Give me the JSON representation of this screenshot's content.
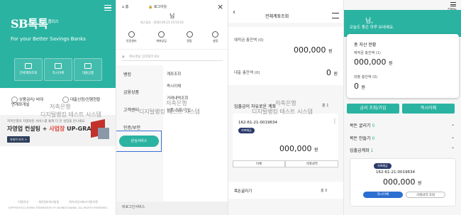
{
  "panel1": {
    "logo": "SB톡톡",
    "logo_suffix": "플러스",
    "tagline": "For your Better Savings Banks",
    "quick_buttons": [
      "전체계좌조회",
      "즉시이체",
      "대출상품"
    ],
    "sublink_left": "상품금리/ 비대면계좌개설",
    "sublink_right": "대출신청/진행현황",
    "banner": {
      "small": "저축은행의 차별화된 서비스를 통해 더 큰 성장을 만나세요",
      "main": "자영업 컨설팅 + 사업장 UP-GRADE",
      "main_a": "자영업 컨설팅 + ",
      "main_b": "사업장",
      "main_c": " UP-GRADE",
      "cta": "자세히 보기 >"
    },
    "footer": [
      "이용안내",
      "개인정보처리방침",
      "위치기반서비스이용약관"
    ],
    "copyright": "COPYRIGHT(C) KOREA FEDERATION OF SAVINGS BANKS. ALL RIGHTS RESERVED."
  },
  "watermark": {
    "line1": "저축은행",
    "line2": "디지털뱅킹 테스트 시스템"
  },
  "panel2": {
    "home": "홈",
    "logout": "로그아웃",
    "name": "님",
    "last_login": "최근접속 : 2020.06.23 15:53:24",
    "icons": [
      "인증센터",
      "계좌상담",
      "알림",
      "설정"
    ],
    "search_placeholder": "메뉴명을 입력해주세요",
    "left_menu": [
      "뱅킹",
      "금융상품",
      "고객센터",
      "인증/보안"
    ],
    "sub_menu": [
      "계좌조회",
      "즉시이체",
      "거래내역조회",
      "상품 조회/가입"
    ],
    "teal_button": "관심서비스",
    "bottom": "비로그인서비스"
  },
  "panel3": {
    "title": "전체계좌조회",
    "deposit_label": "예적금 총잔액 (0)",
    "deposit_amount": "000,000",
    "deposit_unit": "원",
    "loan_label": "대출 총잔액 (0)",
    "loan_amount": "0",
    "loan_unit": "원",
    "section1": "입출금이 자유로운 계좌",
    "section1_count": "총 1",
    "account_no": "162-61-21-0019634",
    "account_tag": "저축예금",
    "account_amount": "000,000",
    "account_unit": "원",
    "btn_transfer": "이체",
    "btn_history": "거래내역",
    "section2": "목돈굴리기",
    "section2_count": "총 0"
  },
  "panel4": {
    "menu_label": "전체메뉴",
    "greeting_name": "님,",
    "greeting_sub": "오늘도 좋은 하루 보내세요.",
    "asset_title": "총 자산 현황",
    "deposit_label": "예적금 총잔액 (1)",
    "deposit_amount": "000,000",
    "deposit_unit": "원",
    "loan_label": "대출 총잔액 (0)",
    "loan_amount": "0",
    "loan_unit": "원",
    "btn_rate": "금리 조회/가입",
    "btn_transfer": "즉시이체",
    "row1": "목돈 굴리기",
    "row1_count": "0",
    "row2": "목돈 만들기",
    "row2_count": "0",
    "row3": "입출금계좌",
    "row3_count": "1",
    "account_tag": "저축예금",
    "account_no": "162-61-21-0019634",
    "account_amount": "000,000",
    "account_unit": "원",
    "btn_acct_transfer": "즉시이체",
    "btn_acct_history": "거래내역 조회"
  },
  "colors": {
    "teal": "#2bb3a2",
    "navy": "#2b3a6b",
    "blue_highlight": "#3b6fd4",
    "red": "#e0453a"
  }
}
